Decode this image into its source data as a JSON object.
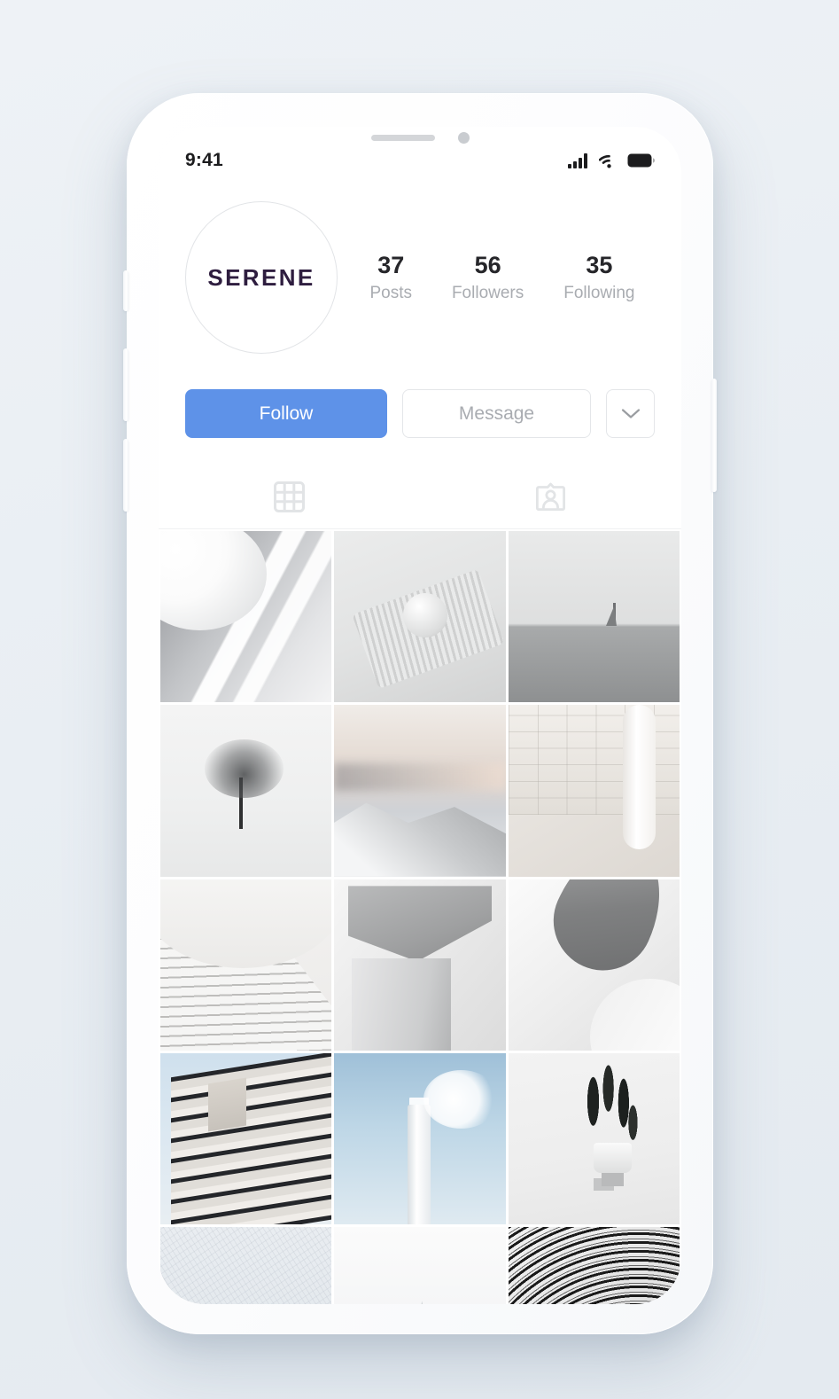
{
  "status_bar": {
    "time": "9:41",
    "icons": [
      "cellular-signal-icon",
      "wifi-icon",
      "battery-icon"
    ]
  },
  "profile": {
    "avatar_label": "SERENE",
    "avatar_text_color": "#2e1d3f",
    "stats": [
      {
        "value": "37",
        "label": "Posts"
      },
      {
        "value": "56",
        "label": "Followers"
      },
      {
        "value": "35",
        "label": "Following"
      }
    ]
  },
  "actions": {
    "follow_label": "Follow",
    "follow_color": "#5e92e8",
    "message_label": "Message",
    "more_icon": "chevron-down-icon"
  },
  "tabs": [
    {
      "name": "grid-tab",
      "icon": "grid-icon",
      "active": true
    },
    {
      "name": "tagged-tab",
      "icon": "person-card-icon",
      "active": false
    }
  ],
  "grid": {
    "columns": 3,
    "tiles": [
      {
        "name": "post-sphere-architecture",
        "art": "art-sphere"
      },
      {
        "name": "post-ceramic-objects",
        "art": "art-ceramics"
      },
      {
        "name": "post-sailboat-sea",
        "art": "art-sail"
      },
      {
        "name": "post-lone-tree-snow",
        "art": "art-tree"
      },
      {
        "name": "post-snowy-mountain-dusk",
        "art": "art-mountain"
      },
      {
        "name": "post-tiled-interior-column",
        "art": "art-interior"
      },
      {
        "name": "post-curved-staircase",
        "art": "art-stairs"
      },
      {
        "name": "post-concrete-architecture",
        "art": "art-brutalist"
      },
      {
        "name": "post-abstract-curve",
        "art": "art-curve"
      },
      {
        "name": "post-modernist-building",
        "art": "art-building"
      },
      {
        "name": "post-lighthouse-sky",
        "art": "art-lighthouse"
      },
      {
        "name": "post-potted-plant",
        "art": "art-plant"
      },
      {
        "name": "post-snow-texture",
        "art": "art-snow"
      },
      {
        "name": "post-misty-peaks",
        "art": "art-mist"
      },
      {
        "name": "post-perforated-mesh",
        "art": "art-mesh"
      }
    ]
  },
  "device": {
    "notch_elements": [
      "speaker-grille",
      "front-camera"
    ],
    "side_buttons": [
      "silent-switch",
      "volume-up",
      "volume-down",
      "power-button"
    ],
    "background_color": "#eef2f6"
  }
}
